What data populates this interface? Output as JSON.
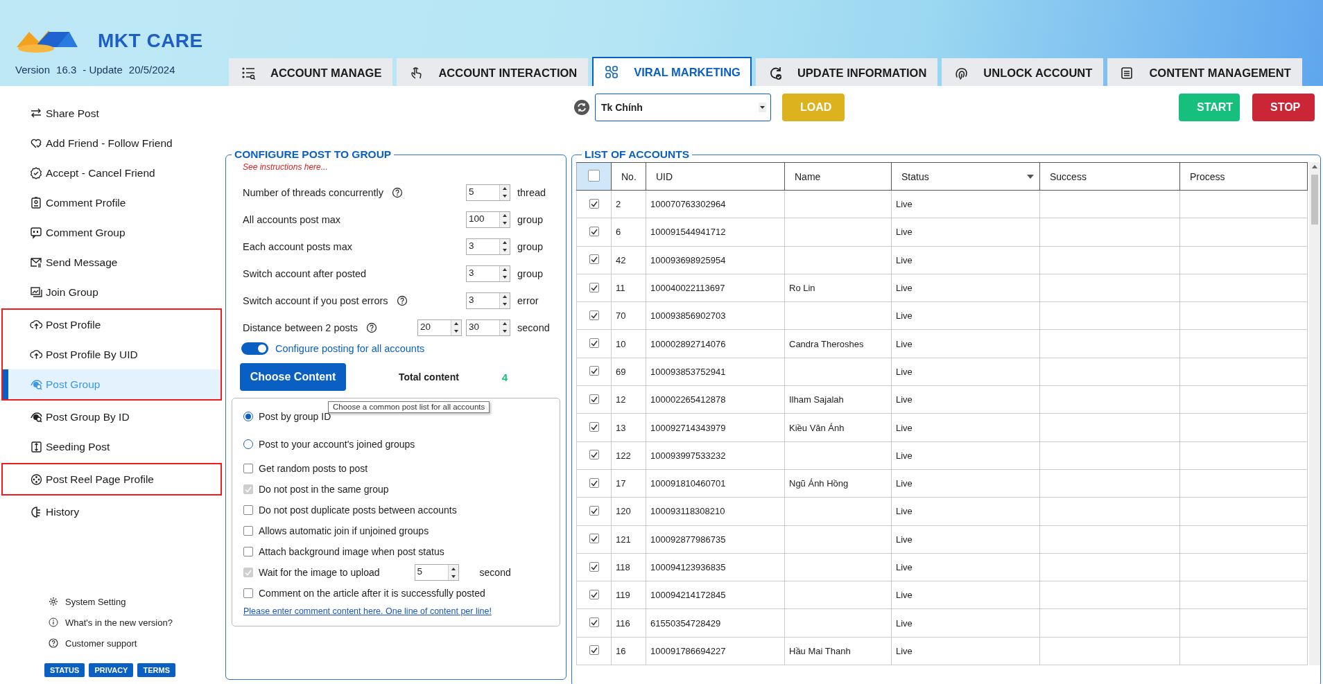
{
  "header": {
    "brand": "MKT CARE",
    "version_label": "Version",
    "version": "16.3",
    "update_label": "- Update",
    "update_date": "20/5/2024"
  },
  "tabs": [
    {
      "label": "ACCOUNT MANAGE",
      "selected": false
    },
    {
      "label": "ACCOUNT INTERACTION",
      "selected": false
    },
    {
      "label": "VIRAL MARKETING",
      "selected": true
    },
    {
      "label": "UPDATE INFORMATION",
      "selected": false
    },
    {
      "label": "UNLOCK ACCOUNT",
      "selected": false
    },
    {
      "label": "CONTENT MANAGEMENT",
      "selected": false
    }
  ],
  "toolbar": {
    "account_group": "Tk Chính",
    "load_button": "LOAD",
    "start_button": "START",
    "stop_button": "STOP"
  },
  "sidebar": {
    "groups": [
      {
        "highlighted": false,
        "items": [
          {
            "label": "Share Post",
            "selected": false
          },
          {
            "label": "Add Friend - Follow Friend",
            "selected": false
          },
          {
            "label": "Accept - Cancel Friend",
            "selected": false
          },
          {
            "label": "Comment Profile",
            "selected": false
          },
          {
            "label": "Comment Group",
            "selected": false
          },
          {
            "label": "Send Message",
            "selected": false
          },
          {
            "label": "Join Group",
            "selected": false
          }
        ]
      },
      {
        "highlighted": true,
        "items": [
          {
            "label": "Post Profile",
            "selected": false
          },
          {
            "label": "Post Profile By UID",
            "selected": false
          },
          {
            "label": "Post Group",
            "selected": true
          }
        ]
      },
      {
        "highlighted": false,
        "items": [
          {
            "label": "Post Group By ID",
            "selected": false
          },
          {
            "label": "Seeding Post",
            "selected": false
          }
        ]
      },
      {
        "highlighted": true,
        "items": [
          {
            "label": "Post Reel Page Profile",
            "selected": false
          }
        ]
      },
      {
        "highlighted": false,
        "items": [
          {
            "label": "History",
            "selected": false
          }
        ]
      }
    ],
    "links": [
      "System Setting",
      "What's in the new version?",
      "Customer support"
    ],
    "footer_buttons": [
      "STATUS",
      "PRIVACY",
      "TERMS"
    ]
  },
  "config": {
    "title": "CONFIGURE POST TO GROUP",
    "instructions_link": "See instructions here...",
    "settings": [
      {
        "label": "Number of threads concurrently",
        "help": true,
        "values": [
          "5"
        ],
        "unit": "thread"
      },
      {
        "label": "All accounts post max",
        "help": false,
        "values": [
          "100"
        ],
        "unit": "group"
      },
      {
        "label": "Each account posts max",
        "help": false,
        "values": [
          "3"
        ],
        "unit": "group"
      },
      {
        "label": "Switch account after posted",
        "help": false,
        "values": [
          "3"
        ],
        "unit": "group"
      },
      {
        "label": "Switch account if you post errors",
        "help": true,
        "values": [
          "3"
        ],
        "unit": "error"
      },
      {
        "label": "Distance between 2 posts",
        "help": true,
        "values": [
          "20",
          "30"
        ],
        "unit": "second"
      }
    ],
    "toggle": {
      "label": "Configure posting for all accounts",
      "on": true
    },
    "choose_button": "Choose Content",
    "total_label": "Total content",
    "total_value": "4",
    "options": [
      {
        "kind": "radio",
        "label": "Post by group ID",
        "selected": true
      },
      {
        "kind": "radio",
        "label": "Post to your account's joined groups",
        "selected": false
      },
      {
        "kind": "checkbox",
        "label": "Get random posts to post",
        "checked": false,
        "disabled": false
      },
      {
        "kind": "checkbox",
        "label": "Do not post in the same group",
        "checked": true,
        "disabled": true
      },
      {
        "kind": "checkbox",
        "label": "Do not post duplicate posts between accounts",
        "checked": false,
        "disabled": false
      },
      {
        "kind": "checkbox",
        "label": "Allows automatic join if unjoined groups",
        "checked": false,
        "disabled": false
      },
      {
        "kind": "checkbox",
        "label": "Attach background image when post status",
        "checked": false,
        "disabled": false
      },
      {
        "kind": "checkbox",
        "label": "Wait for the image to upload",
        "checked": true,
        "disabled": true,
        "value": "5",
        "unit": "second"
      },
      {
        "kind": "checkbox",
        "label": "Comment on the article after it is successfully posted",
        "checked": false,
        "disabled": false
      }
    ],
    "comment_link": "Please enter comment content here. One line of content per line!",
    "tooltip": "Choose a common post list for all accounts"
  },
  "accounts": {
    "title": "LIST OF ACCOUNTS",
    "all_checked": false,
    "columns": [
      "No.",
      "UID",
      "Name",
      "Status",
      "Success",
      "Process"
    ],
    "rows": [
      {
        "checked": true,
        "no": "2",
        "uid": "100070763302964",
        "name": "",
        "status": "Live"
      },
      {
        "checked": true,
        "no": "6",
        "uid": "100091544941712",
        "name": "",
        "status": "Live"
      },
      {
        "checked": true,
        "no": "42",
        "uid": "100093698925954",
        "name": "",
        "status": "Live"
      },
      {
        "checked": true,
        "no": "11",
        "uid": "100040022113697",
        "name": "Ro Lin",
        "status": "Live"
      },
      {
        "checked": true,
        "no": "70",
        "uid": "100093856902703",
        "name": "",
        "status": "Live"
      },
      {
        "checked": true,
        "no": "10",
        "uid": "100002892714076",
        "name": "Candra Theroshes",
        "status": "Live"
      },
      {
        "checked": true,
        "no": "69",
        "uid": "100093853752941",
        "name": "",
        "status": "Live"
      },
      {
        "checked": true,
        "no": "12",
        "uid": "100002265412878",
        "name": "Ilham Sajalah",
        "status": "Live"
      },
      {
        "checked": true,
        "no": "13",
        "uid": "100092714343979",
        "name": "Kiều Văn Ánh",
        "status": "Live"
      },
      {
        "checked": true,
        "no": "122",
        "uid": "100093997533232",
        "name": "",
        "status": "Live"
      },
      {
        "checked": true,
        "no": "17",
        "uid": "100091810460701",
        "name": "Ngũ Ánh Hồng",
        "status": "Live"
      },
      {
        "checked": true,
        "no": "120",
        "uid": "100093118308210",
        "name": "",
        "status": "Live"
      },
      {
        "checked": true,
        "no": "121",
        "uid": "100092877986735",
        "name": "",
        "status": "Live"
      },
      {
        "checked": true,
        "no": "118",
        "uid": "100094123936835",
        "name": "",
        "status": "Live"
      },
      {
        "checked": true,
        "no": "119",
        "uid": "100094214172845",
        "name": "",
        "status": "Live"
      },
      {
        "checked": true,
        "no": "116",
        "uid": "61550354728429",
        "name": "",
        "status": "Live"
      },
      {
        "checked": true,
        "no": "16",
        "uid": "100091786694227",
        "name": "Hầu Mai Thanh",
        "status": "Live"
      }
    ]
  }
}
